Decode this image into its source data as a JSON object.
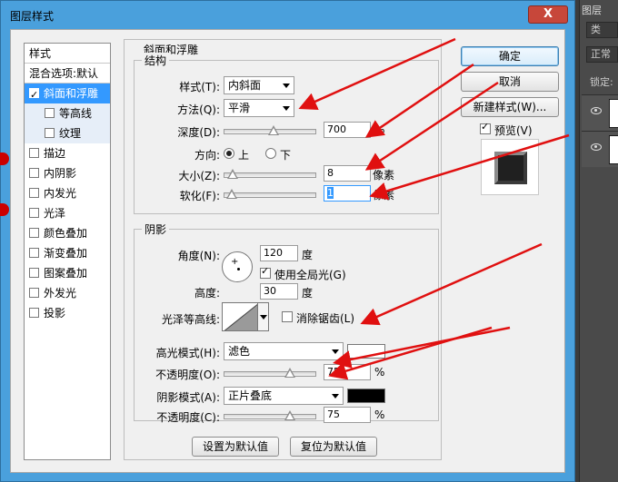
{
  "ps_panel": {
    "tab": "图层",
    "row1": "类",
    "row2": "正常",
    "lock_label": "锁定:"
  },
  "dialog": {
    "title": "图层样式",
    "close_label": "X"
  },
  "style_list": {
    "header": "样式",
    "blend": "混合选项:默认",
    "items": [
      {
        "label": "斜面和浮雕",
        "checked": true
      },
      {
        "label": "等高线",
        "checked": false
      },
      {
        "label": "纹理",
        "checked": false
      },
      {
        "label": "描边",
        "checked": false
      },
      {
        "label": "内阴影",
        "checked": false
      },
      {
        "label": "内发光",
        "checked": false
      },
      {
        "label": "光泽",
        "checked": false
      },
      {
        "label": "颜色叠加",
        "checked": false
      },
      {
        "label": "渐变叠加",
        "checked": false
      },
      {
        "label": "图案叠加",
        "checked": false
      },
      {
        "label": "外发光",
        "checked": false
      },
      {
        "label": "投影",
        "checked": false
      }
    ]
  },
  "bevel": {
    "group_title": "斜面和浮雕",
    "structure_title": "结构",
    "style_label": "样式(T):",
    "style_value": "内斜面",
    "technique_label": "方法(Q):",
    "technique_value": "平滑",
    "depth_label": "深度(D):",
    "depth_value": "700",
    "depth_unit": "%",
    "depth_level": 0.55,
    "direction_label": "方向:",
    "direction_up": "上",
    "direction_down": "下",
    "direction_selected": "up",
    "size_label": "大小(Z):",
    "size_value": "8",
    "size_unit": "像素",
    "size_level": 0.03,
    "soften_label": "软化(F):",
    "soften_value": "1",
    "soften_unit": "像素",
    "soften_level": 0.02
  },
  "shading": {
    "title": "阴影",
    "angle_label": "角度(N):",
    "angle_value": "120",
    "angle_unit": "度",
    "global_light_label": "使用全局光(G)",
    "global_light_checked": true,
    "altitude_label": "高度:",
    "altitude_value": "30",
    "altitude_unit": "度",
    "gloss_label": "光泽等高线:",
    "antialias_label": "消除锯齿(L)",
    "antialias_checked": false,
    "highlight_mode_label": "高光模式(H):",
    "highlight_mode_value": "滤色",
    "highlight_color": "#ffffff",
    "highlight_opacity_label": "不透明度(O):",
    "highlight_opacity_value": "75",
    "highlight_opacity_unit": "%",
    "highlight_opacity_level": 0.75,
    "shadow_mode_label": "阴影模式(A):",
    "shadow_mode_value": "正片叠底",
    "shadow_color": "#000000",
    "shadow_opacity_label": "不透明度(C):",
    "shadow_opacity_value": "75",
    "shadow_opacity_unit": "%",
    "shadow_opacity_level": 0.75
  },
  "footer": {
    "make_default": "设置为默认值",
    "reset_default": "复位为默认值"
  },
  "actions": {
    "ok": "确定",
    "cancel": "取消",
    "new_style": "新建样式(W)...",
    "preview_label": "预览(V)",
    "preview_checked": true
  },
  "colors": {
    "dialog_frame": "#4aa0dc",
    "selection": "#3399ff",
    "annotation_arrow": "#e01010"
  }
}
